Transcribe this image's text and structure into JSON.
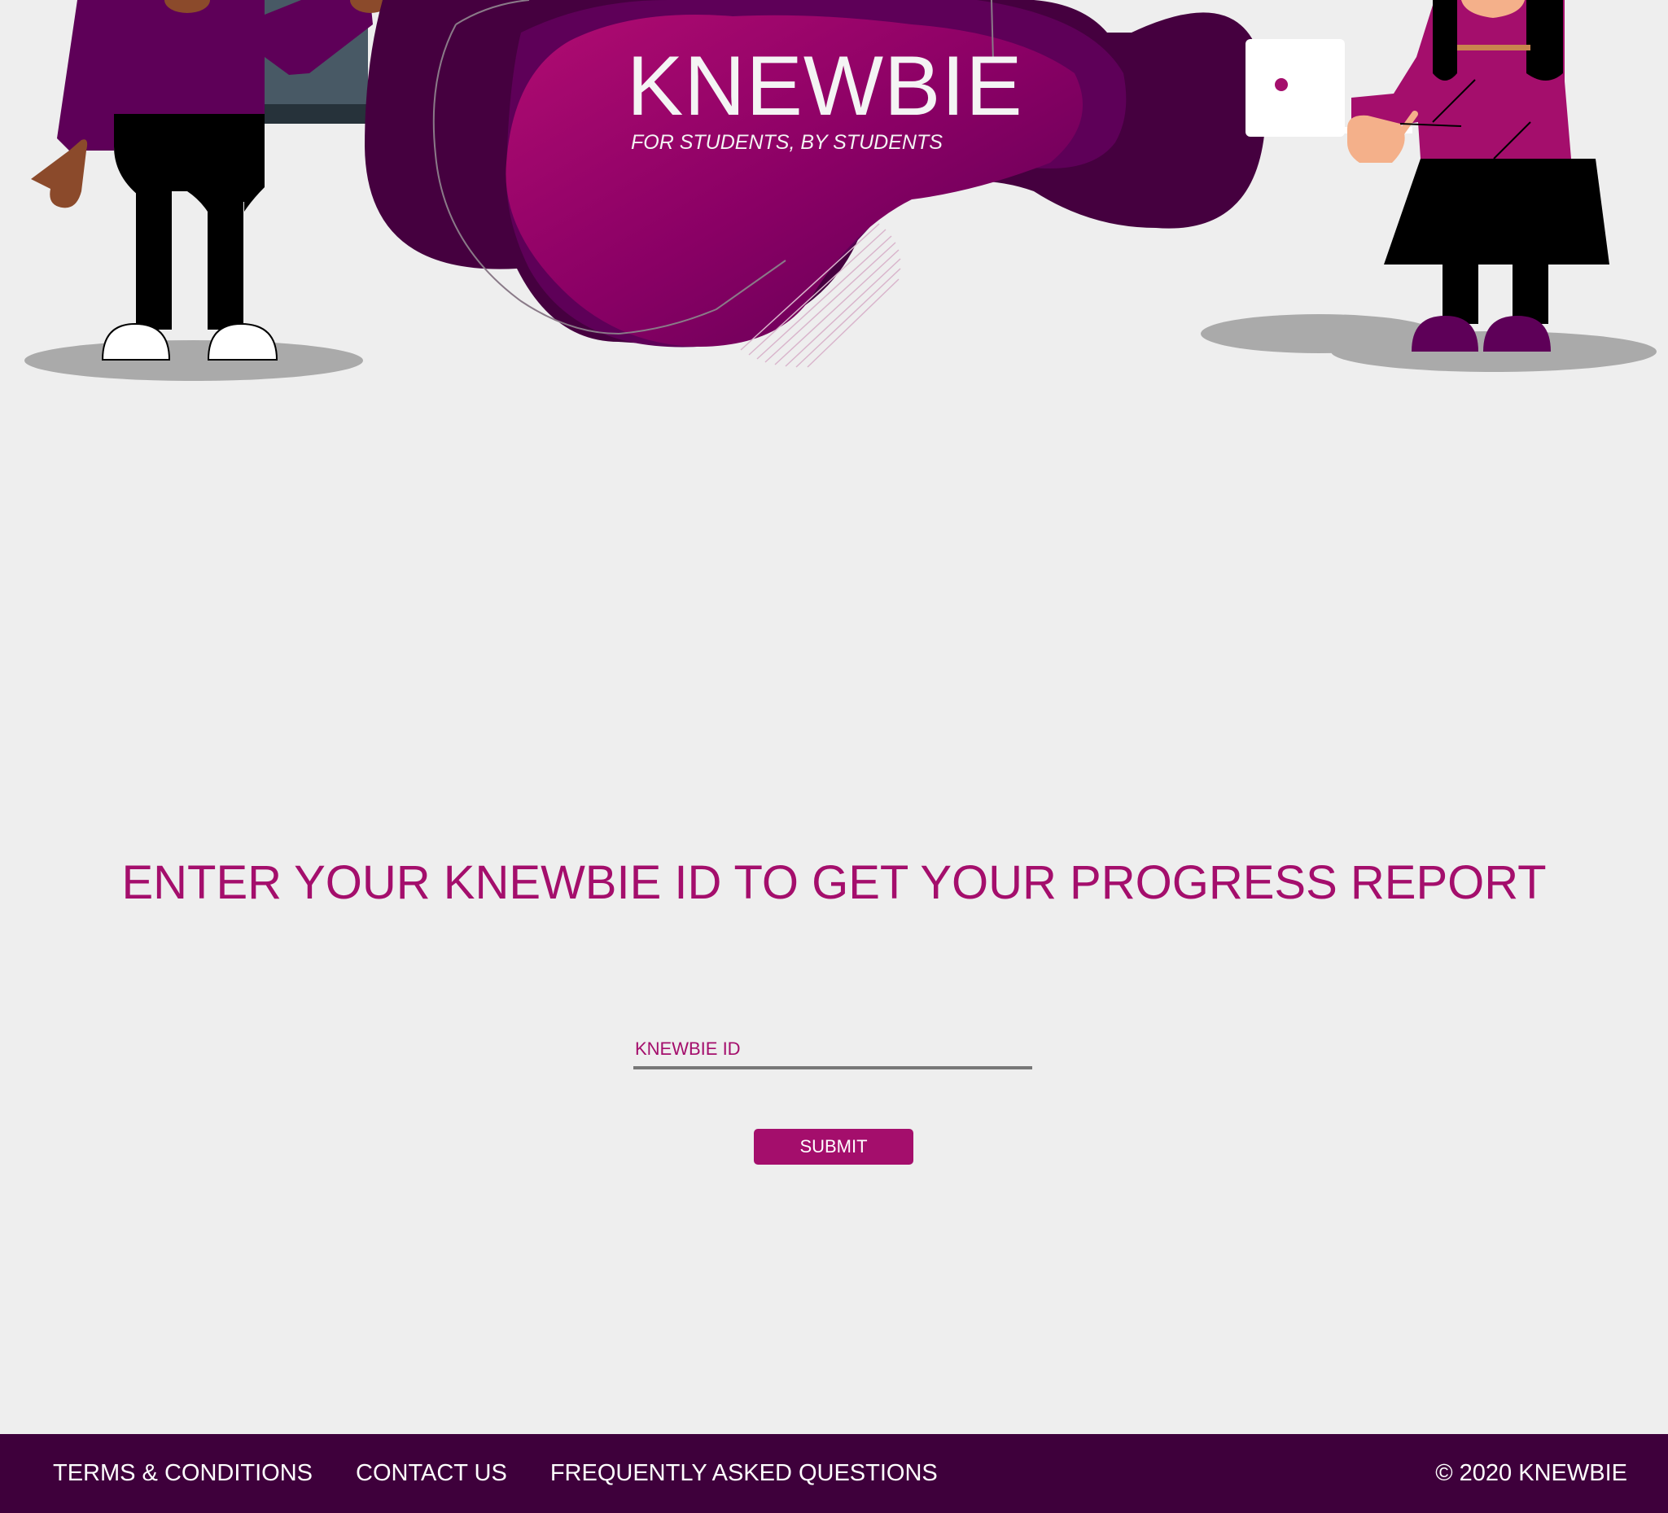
{
  "brand": {
    "title": "KNEWBIE",
    "tagline": "FOR STUDENTS, BY STUDENTS"
  },
  "main": {
    "heading": "ENTER YOUR KNEWBIE ID TO GET YOUR PROGRESS REPORT",
    "id_field": {
      "placeholder": "KNEWBIE ID",
      "value": ""
    },
    "submit_label": "SUBMIT"
  },
  "footer": {
    "links": [
      {
        "label": "TERMS & CONDITIONS"
      },
      {
        "label": "CONTACT US"
      },
      {
        "label": "FREQUENTLY ASKED QUESTIONS"
      }
    ],
    "copyright": "© 2020 KNEWBIE"
  },
  "colors": {
    "accent": "#a40e6c",
    "footer_bg": "#3e003b",
    "page_bg": "#eeeeee",
    "blob_dark": "#45003f",
    "blob_mid": "#5e0058"
  }
}
